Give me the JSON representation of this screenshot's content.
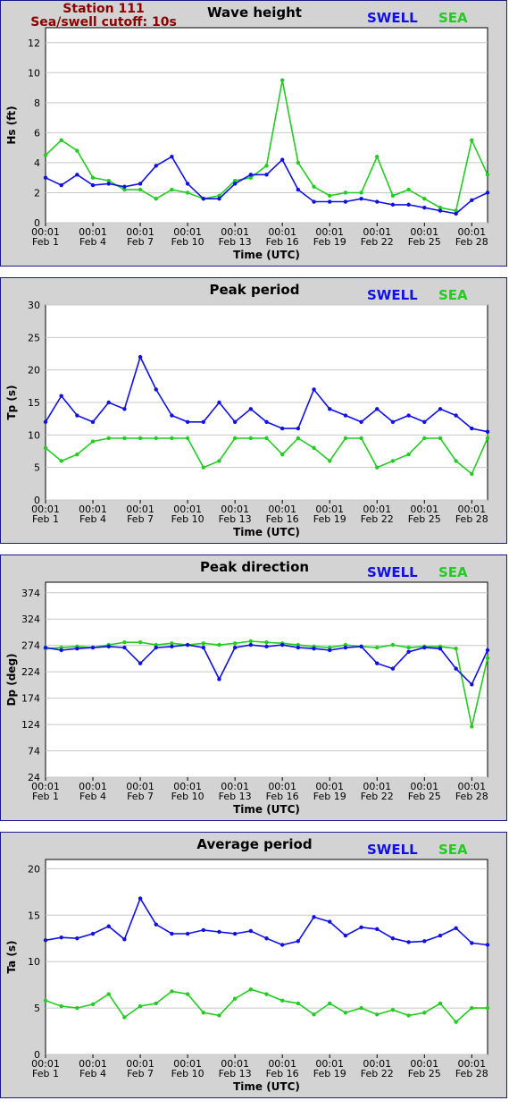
{
  "station": {
    "line1": "Station 111",
    "line2": "Sea/swell cutoff: 10s"
  },
  "legend": {
    "swell": "SWELL",
    "sea": "SEA",
    "swell_color": "#1010e6",
    "sea_color": "#22cc22"
  },
  "chart_data": [
    {
      "type": "line",
      "title": "Wave height",
      "ylabel": "Hs (ft)",
      "xlabel": "Time (UTC)",
      "ylim": [
        0,
        13
      ],
      "yticks": [
        0,
        2,
        4,
        6,
        8,
        10,
        12
      ],
      "x_ticks": [
        {
          "time": "00:01",
          "date": "Feb 1"
        },
        {
          "time": "00:01",
          "date": "Feb 4"
        },
        {
          "time": "00:01",
          "date": "Feb 7"
        },
        {
          "time": "00:01",
          "date": "Feb 10"
        },
        {
          "time": "00:01",
          "date": "Feb 13"
        },
        {
          "time": "00:01",
          "date": "Feb 16"
        },
        {
          "time": "00:01",
          "date": "Feb 19"
        },
        {
          "time": "00:01",
          "date": "Feb 22"
        },
        {
          "time": "00:01",
          "date": "Feb 25"
        },
        {
          "time": "00:01",
          "date": "Feb 28"
        }
      ],
      "x": [
        "Feb 1",
        "Feb 2",
        "Feb 3",
        "Feb 4",
        "Feb 5",
        "Feb 6",
        "Feb 7",
        "Feb 8",
        "Feb 9",
        "Feb 10",
        "Feb 11",
        "Feb 12",
        "Feb 13",
        "Feb 14",
        "Feb 15",
        "Feb 16",
        "Feb 17",
        "Feb 18",
        "Feb 19",
        "Feb 20",
        "Feb 21",
        "Feb 22",
        "Feb 23",
        "Feb 24",
        "Feb 25",
        "Feb 26",
        "Feb 27",
        "Feb 28",
        "Mar 1"
      ],
      "series": [
        {
          "name": "SWELL",
          "color": "#1010e6",
          "values": [
            3.0,
            2.5,
            3.2,
            2.5,
            2.6,
            2.4,
            2.6,
            3.8,
            4.4,
            2.6,
            1.6,
            1.6,
            2.6,
            3.2,
            3.2,
            4.2,
            2.2,
            1.4,
            1.4,
            1.4,
            1.6,
            1.4,
            1.2,
            1.2,
            1.0,
            0.8,
            0.6,
            1.5,
            2.0
          ]
        },
        {
          "name": "SEA",
          "color": "#22cc22",
          "values": [
            4.5,
            5.5,
            4.8,
            3.0,
            2.8,
            2.2,
            2.2,
            1.6,
            2.2,
            2.0,
            1.6,
            1.8,
            2.8,
            3.0,
            3.8,
            9.5,
            4.0,
            2.4,
            1.8,
            2.0,
            2.0,
            4.4,
            1.8,
            2.2,
            1.6,
            1.0,
            0.8,
            5.5,
            3.2
          ]
        }
      ]
    },
    {
      "type": "line",
      "title": "Peak period",
      "ylabel": "Tp (s)",
      "xlabel": "Time (UTC)",
      "ylim": [
        0,
        30
      ],
      "yticks": [
        0,
        5,
        10,
        15,
        20,
        25,
        30
      ],
      "x_ticks": [
        {
          "time": "00:01",
          "date": "Feb 1"
        },
        {
          "time": "00:01",
          "date": "Feb 4"
        },
        {
          "time": "00:01",
          "date": "Feb 7"
        },
        {
          "time": "00:01",
          "date": "Feb 10"
        },
        {
          "time": "00:01",
          "date": "Feb 13"
        },
        {
          "time": "00:01",
          "date": "Feb 16"
        },
        {
          "time": "00:01",
          "date": "Feb 19"
        },
        {
          "time": "00:01",
          "date": "Feb 22"
        },
        {
          "time": "00:01",
          "date": "Feb 25"
        },
        {
          "time": "00:01",
          "date": "Feb 28"
        }
      ],
      "x": [
        "Feb 1",
        "Feb 2",
        "Feb 3",
        "Feb 4",
        "Feb 5",
        "Feb 6",
        "Feb 7",
        "Feb 8",
        "Feb 9",
        "Feb 10",
        "Feb 11",
        "Feb 12",
        "Feb 13",
        "Feb 14",
        "Feb 15",
        "Feb 16",
        "Feb 17",
        "Feb 18",
        "Feb 19",
        "Feb 20",
        "Feb 21",
        "Feb 22",
        "Feb 23",
        "Feb 24",
        "Feb 25",
        "Feb 26",
        "Feb 27",
        "Feb 28",
        "Mar 1"
      ],
      "series": [
        {
          "name": "SWELL",
          "color": "#1010e6",
          "values": [
            12,
            16,
            13,
            12,
            15,
            14,
            22,
            17,
            13,
            12,
            12,
            15,
            12,
            14,
            12,
            11,
            11,
            17,
            14,
            13,
            12,
            14,
            12,
            13,
            12,
            14,
            13,
            11,
            10.5
          ]
        },
        {
          "name": "SEA",
          "color": "#22cc22",
          "values": [
            8,
            6,
            7,
            9,
            9.5,
            9.5,
            9.5,
            9.5,
            9.5,
            9.5,
            5,
            6,
            9.5,
            9.5,
            9.5,
            7,
            9.5,
            8,
            6,
            9.5,
            9.5,
            5,
            6,
            7,
            9.5,
            9.5,
            6,
            4,
            9.5
          ]
        }
      ]
    },
    {
      "type": "line",
      "title": "Peak direction",
      "ylabel": "Dp (deg)",
      "xlabel": "Time (UTC)",
      "ylim": [
        24,
        394
      ],
      "yticks": [
        24,
        74,
        124,
        174,
        224,
        274,
        324,
        374
      ],
      "x_ticks": [
        {
          "time": "00:01",
          "date": "Feb 1"
        },
        {
          "time": "00:01",
          "date": "Feb 4"
        },
        {
          "time": "00:01",
          "date": "Feb 7"
        },
        {
          "time": "00:01",
          "date": "Feb 10"
        },
        {
          "time": "00:01",
          "date": "Feb 13"
        },
        {
          "time": "00:01",
          "date": "Feb 16"
        },
        {
          "time": "00:01",
          "date": "Feb 19"
        },
        {
          "time": "00:01",
          "date": "Feb 22"
        },
        {
          "time": "00:01",
          "date": "Feb 25"
        },
        {
          "time": "00:01",
          "date": "Feb 28"
        }
      ],
      "x": [
        "Feb 1",
        "Feb 2",
        "Feb 3",
        "Feb 4",
        "Feb 5",
        "Feb 6",
        "Feb 7",
        "Feb 8",
        "Feb 9",
        "Feb 10",
        "Feb 11",
        "Feb 12",
        "Feb 13",
        "Feb 14",
        "Feb 15",
        "Feb 16",
        "Feb 17",
        "Feb 18",
        "Feb 19",
        "Feb 20",
        "Feb 21",
        "Feb 22",
        "Feb 23",
        "Feb 24",
        "Feb 25",
        "Feb 26",
        "Feb 27",
        "Feb 28",
        "Mar 1"
      ],
      "series": [
        {
          "name": "SWELL",
          "color": "#1010e6",
          "values": [
            270,
            265,
            268,
            270,
            272,
            270,
            240,
            270,
            272,
            275,
            270,
            210,
            270,
            275,
            272,
            275,
            270,
            268,
            265,
            270,
            272,
            240,
            230,
            262,
            270,
            268,
            230,
            200,
            265
          ]
        },
        {
          "name": "SEA",
          "color": "#22cc22",
          "values": [
            268,
            270,
            272,
            270,
            275,
            280,
            280,
            275,
            278,
            275,
            278,
            275,
            278,
            282,
            280,
            278,
            275,
            272,
            270,
            275,
            272,
            270,
            275,
            270,
            272,
            272,
            268,
            120,
            250
          ]
        }
      ]
    },
    {
      "type": "line",
      "title": "Average period",
      "ylabel": "Ta (s)",
      "xlabel": "Time (UTC)",
      "ylim": [
        0,
        21
      ],
      "yticks": [
        0,
        5,
        10,
        15,
        20
      ],
      "x_ticks": [
        {
          "time": "00:01",
          "date": "Feb 1"
        },
        {
          "time": "00:01",
          "date": "Feb 4"
        },
        {
          "time": "00:01",
          "date": "Feb 7"
        },
        {
          "time": "00:01",
          "date": "Feb 10"
        },
        {
          "time": "00:01",
          "date": "Feb 13"
        },
        {
          "time": "00:01",
          "date": "Feb 16"
        },
        {
          "time": "00:01",
          "date": "Feb 19"
        },
        {
          "time": "00:01",
          "date": "Feb 22"
        },
        {
          "time": "00:01",
          "date": "Feb 25"
        },
        {
          "time": "00:01",
          "date": "Feb 28"
        }
      ],
      "x": [
        "Feb 1",
        "Feb 2",
        "Feb 3",
        "Feb 4",
        "Feb 5",
        "Feb 6",
        "Feb 7",
        "Feb 8",
        "Feb 9",
        "Feb 10",
        "Feb 11",
        "Feb 12",
        "Feb 13",
        "Feb 14",
        "Feb 15",
        "Feb 16",
        "Feb 17",
        "Feb 18",
        "Feb 19",
        "Feb 20",
        "Feb 21",
        "Feb 22",
        "Feb 23",
        "Feb 24",
        "Feb 25",
        "Feb 26",
        "Feb 27",
        "Feb 28",
        "Mar 1"
      ],
      "series": [
        {
          "name": "SWELL",
          "color": "#1010e6",
          "values": [
            12.3,
            12.6,
            12.5,
            13.0,
            13.8,
            12.4,
            16.8,
            14.0,
            13.0,
            13.0,
            13.4,
            13.2,
            13.0,
            13.3,
            12.5,
            11.8,
            12.2,
            14.8,
            14.3,
            12.8,
            13.7,
            13.5,
            12.5,
            12.1,
            12.2,
            12.8,
            13.6,
            12.0,
            11.8
          ]
        },
        {
          "name": "SEA",
          "color": "#22cc22",
          "values": [
            5.8,
            5.2,
            5.0,
            5.4,
            6.5,
            4.0,
            5.2,
            5.5,
            6.8,
            6.5,
            4.5,
            4.2,
            6.0,
            7.0,
            6.5,
            5.8,
            5.5,
            4.3,
            5.5,
            4.5,
            5.0,
            4.3,
            4.8,
            4.2,
            4.5,
            5.5,
            3.5,
            5.0,
            5.0
          ]
        }
      ]
    }
  ]
}
